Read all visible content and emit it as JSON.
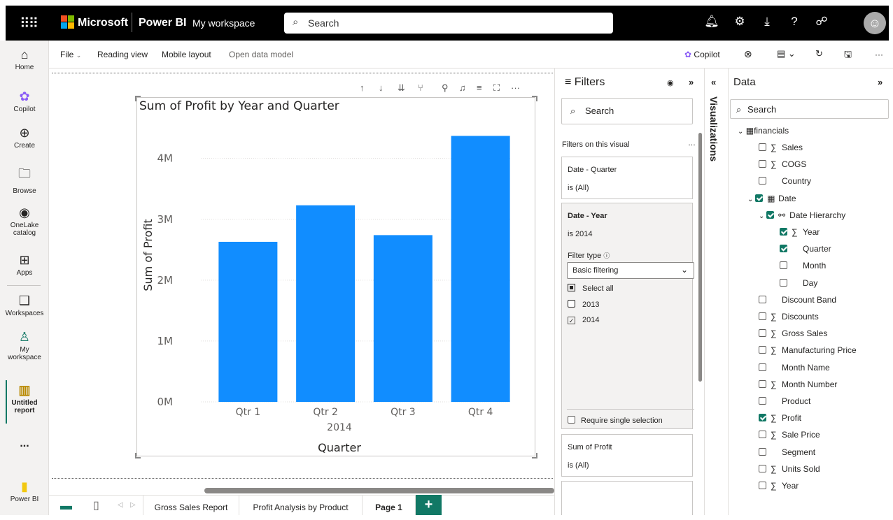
{
  "topbar": {
    "brand": "Microsoft",
    "product": "Power BI",
    "workspace": "My workspace",
    "search_placeholder": "Search"
  },
  "leftnav": {
    "items": [
      {
        "label": "Home",
        "icon": "home-icon"
      },
      {
        "label": "Copilot",
        "icon": "copilot-icon"
      },
      {
        "label": "Create",
        "icon": "plus-circle-icon"
      },
      {
        "label": "Browse",
        "icon": "folder-icon"
      },
      {
        "label": "OneLake catalog",
        "icon": "onelake-icon"
      },
      {
        "label": "Apps",
        "icon": "apps-icon"
      },
      {
        "label": "Workspaces",
        "icon": "workspaces-icon"
      },
      {
        "label": "My workspace",
        "icon": "person-icon"
      },
      {
        "label": "Untitled report",
        "icon": "report-icon"
      },
      {
        "label": "...",
        "icon": "more-icon"
      },
      {
        "label": "Power BI",
        "icon": "powerbi-icon"
      }
    ]
  },
  "ribbon": {
    "file": "File",
    "reading_view": "Reading view",
    "mobile_layout": "Mobile layout",
    "open_data_model": "Open data model",
    "copilot": "Copilot"
  },
  "chart_data": {
    "type": "bar",
    "title": "Sum of Profit by Year and Quarter",
    "ylabel": "Sum of Profit",
    "xlabel": "Quarter",
    "year_label": "2014",
    "categories": [
      "Qtr 1",
      "Qtr 2",
      "Qtr 3",
      "Qtr 4"
    ],
    "values": [
      2.63,
      3.23,
      2.74,
      4.37
    ],
    "yticks": [
      "0M",
      "1M",
      "2M",
      "3M",
      "4M"
    ],
    "ylim": [
      0,
      4.8
    ],
    "bar_color": "#118DFF",
    "grid": true
  },
  "tabs": [
    "Gross Sales Report",
    "Profit Analysis by Product",
    "Page 1"
  ],
  "filters": {
    "title": "Filters",
    "search_placeholder": "Search",
    "section": "Filters on this visual",
    "card1_title": "Date - Quarter",
    "card1_value": "is (All)",
    "card2_title": "Date - Year",
    "card2_value": "is 2014",
    "filter_type_label": "Filter type",
    "filter_type_value": "Basic filtering",
    "options": [
      "Select all",
      "2013",
      "2014"
    ],
    "require_single": "Require single selection",
    "card3_title": "Sum of Profit",
    "card3_value": "is (All)"
  },
  "visualizations_label": "Visualizations",
  "data_pane": {
    "title": "Data",
    "search_placeholder": "Search",
    "table": "financials",
    "fields": [
      {
        "label": "Sales",
        "sigma": true,
        "checked": false,
        "indent": 0
      },
      {
        "label": "COGS",
        "sigma": true,
        "checked": false,
        "indent": 0
      },
      {
        "label": "Country",
        "sigma": false,
        "checked": false,
        "indent": 0
      },
      {
        "label": "Date",
        "sigma": false,
        "checked": true,
        "indent": -1
      },
      {
        "label": "Date Hierarchy",
        "sigma": false,
        "checked": true,
        "indent": -2
      },
      {
        "label": "Year",
        "sigma": true,
        "checked": true,
        "indent": 2
      },
      {
        "label": "Quarter",
        "sigma": false,
        "checked": true,
        "indent": 2
      },
      {
        "label": "Month",
        "sigma": false,
        "checked": false,
        "indent": 2
      },
      {
        "label": "Day",
        "sigma": false,
        "checked": false,
        "indent": 2
      },
      {
        "label": "Discount Band",
        "sigma": false,
        "checked": false,
        "indent": 0
      },
      {
        "label": "Discounts",
        "sigma": true,
        "checked": false,
        "indent": 0
      },
      {
        "label": "Gross Sales",
        "sigma": true,
        "checked": false,
        "indent": 0
      },
      {
        "label": "Manufacturing Price",
        "sigma": true,
        "checked": false,
        "indent": 0
      },
      {
        "label": "Month Name",
        "sigma": false,
        "checked": false,
        "indent": 0
      },
      {
        "label": "Month Number",
        "sigma": true,
        "checked": false,
        "indent": 0
      },
      {
        "label": "Product",
        "sigma": false,
        "checked": false,
        "indent": 0
      },
      {
        "label": "Profit",
        "sigma": true,
        "checked": true,
        "indent": 0
      },
      {
        "label": "Sale Price",
        "sigma": true,
        "checked": false,
        "indent": 0
      },
      {
        "label": "Segment",
        "sigma": false,
        "checked": false,
        "indent": 0
      },
      {
        "label": "Units Sold",
        "sigma": true,
        "checked": false,
        "indent": 0
      },
      {
        "label": "Year",
        "sigma": true,
        "checked": false,
        "indent": 0
      }
    ]
  }
}
